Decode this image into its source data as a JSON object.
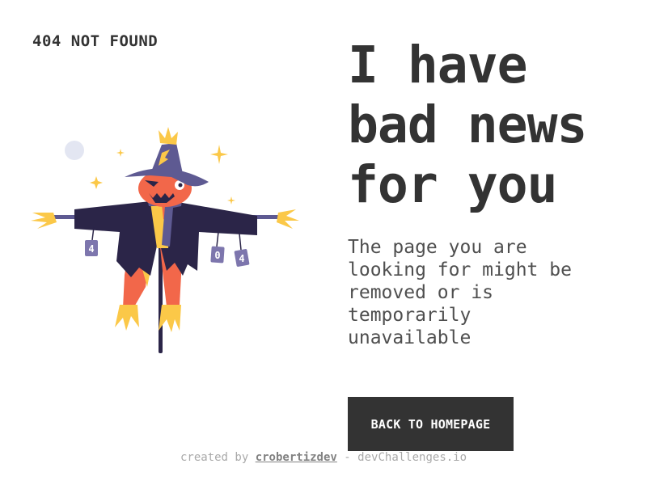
{
  "brand": {
    "label": "404 NOT FOUND"
  },
  "headline": {
    "lines": [
      "I have",
      "bad news",
      "for you"
    ]
  },
  "message": {
    "lines": [
      "The page you are",
      "looking for might be",
      "removed or is",
      "temporarily",
      "unavailable"
    ]
  },
  "button": {
    "label": "BACK TO HOMEPAGE"
  },
  "illustration": {
    "can_labels": [
      "4",
      "0",
      "4"
    ]
  },
  "footer": {
    "prefix": "created by",
    "author": "crobertizdev",
    "separator": "-",
    "site": "devChallenges.io"
  },
  "colors": {
    "text": "#333333",
    "button_bg": "#333333",
    "button_text": "#ffffff",
    "coat": "#2b2548",
    "hat": "#5e5a92",
    "pumpkin": "#f2674a",
    "straw": "#fbc848",
    "footer_text": "#a9a9a9"
  }
}
